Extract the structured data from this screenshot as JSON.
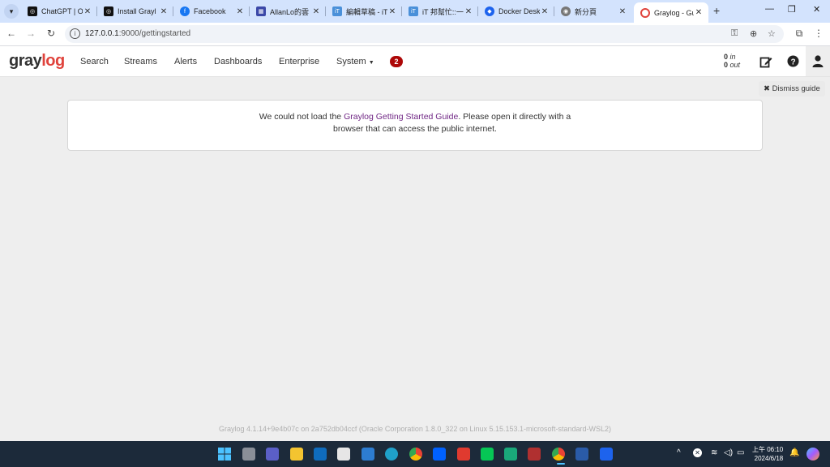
{
  "browser": {
    "tabs": [
      {
        "title": "ChatGPT | O",
        "icon": "chatgpt-icon",
        "color": "#000000"
      },
      {
        "title": "Install Grayl",
        "icon": "chatgpt-icon",
        "color": "#000000"
      },
      {
        "title": "Facebook",
        "icon": "facebook-icon",
        "color": "#1877f2"
      },
      {
        "title": "AllanLo的雲",
        "icon": "site-icon",
        "color": "#3b48a8"
      },
      {
        "title": "編輯草稿 - iT",
        "icon": "ithome-icon",
        "color": "#4a90d9"
      },
      {
        "title": "iT 邦幫忙::一",
        "icon": "ithome-icon",
        "color": "#4a90d9"
      },
      {
        "title": "Docker Desk",
        "icon": "docker-icon",
        "color": "#1d63ed"
      },
      {
        "title": "新分頁",
        "icon": "chrome-icon",
        "color": "#555555"
      },
      {
        "title": "Graylog - Gu",
        "icon": "graylog-icon",
        "color": "#e0433c",
        "active": true
      }
    ],
    "url_host": "127.0.0.1",
    "url_path": ":9000/gettingstarted"
  },
  "graylog": {
    "logo_left": "gray",
    "logo_right": "log",
    "nav": [
      "Search",
      "Streams",
      "Alerts",
      "Dashboards",
      "Enterprise",
      "System"
    ],
    "notification_count": "2",
    "throughput_in_value": "0",
    "throughput_in_label": "in",
    "throughput_out_value": "0",
    "throughput_out_label": "out",
    "dismiss_label": "Dismiss guide",
    "guide_text_1": "We could not load the ",
    "guide_link": "Graylog Getting Started Guide",
    "guide_text_2": ". Please open it directly with a",
    "guide_text_3": "browser that can access the public internet.",
    "footer": "Graylog 4.1.14+9e4b07c on 2a752db04ccf (Oracle Corporation 1.8.0_322 on Linux 5.15.153.1-microsoft-standard-WSL2)",
    "accent_color": "#702785",
    "brand_color": "#e0433c",
    "badge_color": "#ad0707"
  },
  "taskbar": {
    "clock_time": "上午 06:10",
    "clock_date": "2024/6/18"
  }
}
